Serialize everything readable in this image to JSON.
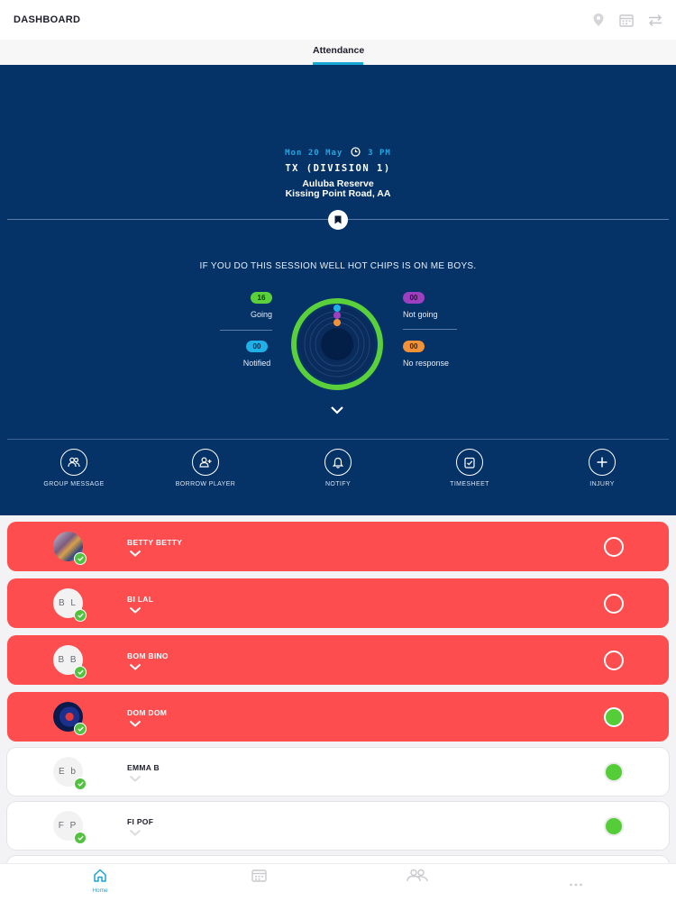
{
  "header": {
    "title": "DASHBOARD",
    "icons": [
      "location-pin-icon",
      "calendar-icon",
      "swap-icon"
    ]
  },
  "tabs": [
    {
      "label": "Attendance",
      "active": true
    }
  ],
  "event": {
    "date": "Mon 20 May",
    "time": "3 PM",
    "team": "TX (DIVISION 1)",
    "venue_line1": "Auluba Reserve",
    "venue_line2": "Kissing Point Road, AA",
    "message": "IF YOU DO THIS SESSION WELL HOT CHIPS IS ON ME BOYS."
  },
  "stats": {
    "going": {
      "count": "16",
      "label": "Going",
      "color": "#5ad13a"
    },
    "notified": {
      "count": "00",
      "label": "Notified",
      "color": "#1fb0e8"
    },
    "not_going": {
      "count": "00",
      "label": "Not going",
      "color": "#9d3fbf"
    },
    "no_response": {
      "count": "00",
      "label": "No response",
      "color": "#f29238"
    }
  },
  "actions": [
    {
      "label": "GROUP MESSAGE",
      "icon": "group-icon"
    },
    {
      "label": "BORROW PLAYER",
      "icon": "add-user-icon"
    },
    {
      "label": "NOTIFY",
      "icon": "bell-icon"
    },
    {
      "label": "TIMESHEET",
      "icon": "clipboard-check-icon"
    },
    {
      "label": "INJURY",
      "icon": "plus-icon"
    }
  ],
  "players": [
    {
      "name": "BETTY BETTY",
      "initials": "",
      "avatar": "photo",
      "row_color": "red",
      "status": "empty"
    },
    {
      "name": "BI LAL",
      "initials": "B L",
      "avatar": "initials",
      "row_color": "red",
      "status": "empty"
    },
    {
      "name": "BOM BINO",
      "initials": "B B",
      "avatar": "initials",
      "row_color": "red",
      "status": "empty"
    },
    {
      "name": "DOM DOM",
      "initials": "",
      "avatar": "photo",
      "row_color": "red",
      "status": "filled"
    },
    {
      "name": "EMMA B",
      "initials": "E b",
      "avatar": "initials",
      "row_color": "white",
      "status": "filled"
    },
    {
      "name": "FI POF",
      "initials": "F P",
      "avatar": "initials",
      "row_color": "white",
      "status": "filled"
    }
  ],
  "bottom_nav": [
    {
      "label": "Home",
      "icon": "home-icon",
      "active": true
    },
    {
      "label": "",
      "icon": "calendar-icon",
      "active": false
    },
    {
      "label": "",
      "icon": "people-icon",
      "active": false
    },
    {
      "label": "",
      "icon": "more-icon",
      "active": false
    }
  ],
  "colors": {
    "hero_bg": "#053267",
    "accent": "#17a8d6",
    "row_red": "#fe4d4f",
    "going_green": "#5ad13a"
  }
}
